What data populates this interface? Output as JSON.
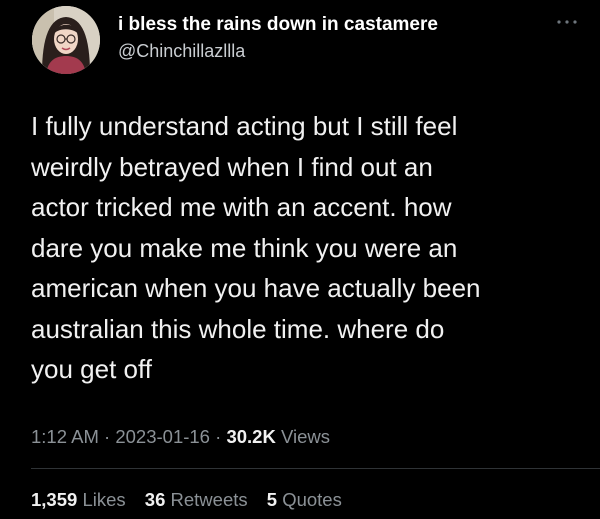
{
  "author": {
    "display_name": "i bless the rains down in castamere",
    "handle": "@Chinchillazllla",
    "avatar_icon": "profile-photo"
  },
  "more_icon": "ellipsis-icon",
  "tweet": {
    "lines": [
      "I fully understand acting but I still feel",
      "weirdly betrayed when I find out an",
      "actor tricked me with an accent. how",
      "dare you make me think you were an",
      "american when you have actually been",
      "australian this whole time. where do",
      "you get off"
    ]
  },
  "meta": {
    "time": "1:12 AM",
    "separator": "·",
    "date": "2023-01-16",
    "views_count": "30.2K",
    "views_label": "Views"
  },
  "stats": {
    "likes_count": "1,359",
    "likes_label": "Likes",
    "retweets_count": "36",
    "retweets_label": "Retweets",
    "quotes_count": "5",
    "quotes_label": "Quotes"
  },
  "colors": {
    "background": "#000000",
    "primary_text": "#e7e9ea",
    "secondary_text": "#8b9196",
    "divider": "#2f3336"
  }
}
